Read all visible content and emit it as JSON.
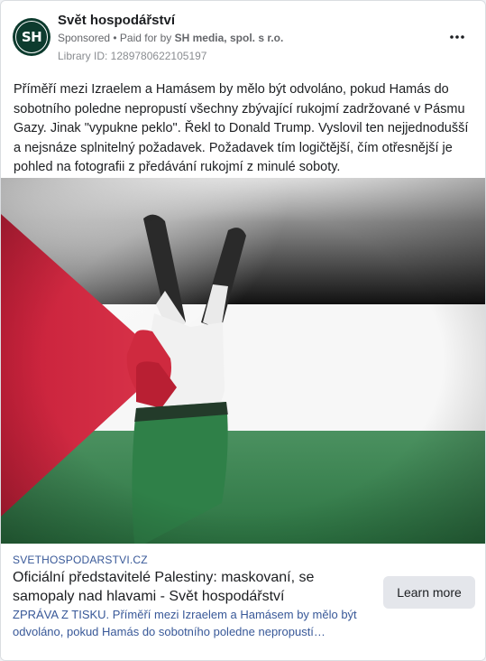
{
  "header": {
    "avatar_initials": "SH",
    "page_name": "Svět hospodářství",
    "sponsored_label": "Sponsored",
    "separator": " • ",
    "paid_for_prefix": "Paid for by ",
    "payer": "SH media, spol. s r.o.",
    "library_id": "Library ID: 1289780622105197",
    "more_icon": "more-horizontal-icon"
  },
  "post": {
    "text": "Příměří mezi Izraelem a Hamásem by mělo být odvoláno, pokud Hamás do sobotního poledne nepropustí všechny zbývající rukojmí zadržované v Pásmu Gazy. Jinak \"vypukne peklo\". Řekl to Donald Trump. Vyslovil ten nejjednodušší a nejsnáze splnitelný požadavek. Požadavek tím logičtější, čím otřesnější je pohled na fotografii z předávání rukojmí z minulé soboty."
  },
  "link": {
    "domain": "SVETHOSPODARSTVI.CZ",
    "title": "Oficiální představitelé Palestiny: maskovaní, se samopaly nad hlavami - Svět hospodářství",
    "description": "ZPRÁVA Z TISKU. Příměří mezi Izraelem a Hamásem by mělo být odvoláno, pokud Hamás do sobotního poledne nepropustí…",
    "cta_label": "Learn more"
  },
  "colors": {
    "flag_red": "#d6273d",
    "flag_green": "#2f7d45",
    "flag_black": "#1a1a1a",
    "link_blue": "#385898",
    "avatar_bg": "#0d3b2e"
  }
}
